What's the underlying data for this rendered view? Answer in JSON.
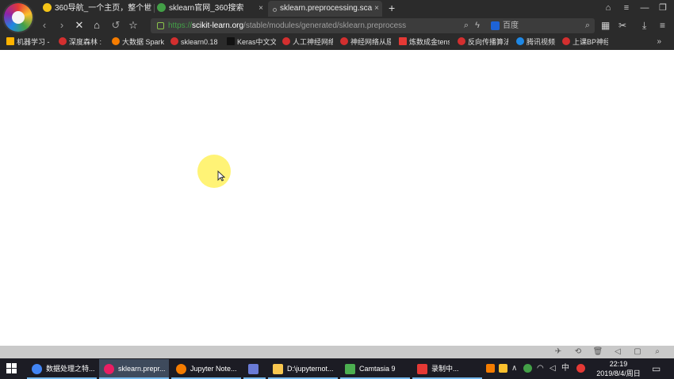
{
  "browser": {
    "tabs": [
      {
        "title": "360导航_一个主页，整个世",
        "close": "×",
        "color": "#f5c518"
      },
      {
        "title": "sklearn官网_360搜索",
        "close": "×",
        "color": "#43a047"
      },
      {
        "title": "sklearn.preprocessing.sca",
        "close": "×",
        "color": "#9e9e9e"
      }
    ],
    "new_tab": "+",
    "url": {
      "scheme": "https://",
      "host": "scikit-learn.org",
      "path": "/stable/modules/generated/sklearn.preprocess"
    },
    "search_placeholder": "百度",
    "bookmarks": [
      {
        "label": "机器学习 -",
        "color": "#ffb300"
      },
      {
        "label": "深度森林 :",
        "color": "#d32f2f"
      },
      {
        "label": "大数据 Spark",
        "color": "#f57c00"
      },
      {
        "label": "sklearn0.18",
        "color": "#d32f2f"
      },
      {
        "label": "Keras中文文",
        "color": "#111111"
      },
      {
        "label": "人工神经网络",
        "color": "#d32f2f"
      },
      {
        "label": "神经网络从原",
        "color": "#d32f2f"
      },
      {
        "label": "炼数成金tens",
        "color": "#e53935"
      },
      {
        "label": "反向传播算法",
        "color": "#d32f2f"
      },
      {
        "label": "腾讯视频",
        "color": "#1e88e5"
      },
      {
        "label": "上课BP神经",
        "color": "#d32f2f"
      }
    ],
    "bookmarks_more": "»"
  },
  "taskbar": {
    "items": [
      {
        "label": "数据处理之特...",
        "color": "#4285f4"
      },
      {
        "label": "sklearn.prepr...",
        "color": "#e91e63"
      },
      {
        "label": "Jupyter Note...",
        "color": "#f57c00"
      },
      {
        "label": "",
        "color": "#6a7bd6"
      },
      {
        "label": "D:\\jupyternot...",
        "color": "#f9c74f"
      },
      {
        "label": "Camtasia 9",
        "color": "#4caf50"
      },
      {
        "label": "录制中...",
        "color": "#e53935"
      }
    ],
    "ime": "中",
    "clock_time": "22:19",
    "clock_date": "2019/8/4/周日"
  }
}
